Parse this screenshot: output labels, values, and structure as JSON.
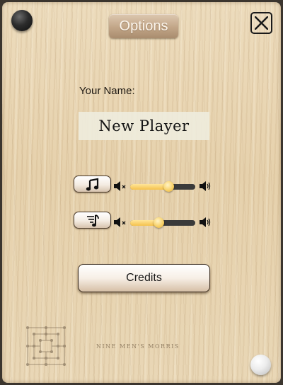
{
  "header": {
    "title": "Options",
    "close_icon": "close-icon"
  },
  "player": {
    "name_label": "Your Name:",
    "name_value": "New Player"
  },
  "audio": {
    "music": {
      "icon": "music-note-icon",
      "volume": 0.59
    },
    "sfx": {
      "icon": "sound-effects-icon",
      "volume": 0.43
    },
    "mute_icon": "speaker-mute-icon",
    "loud_icon": "speaker-loud-icon"
  },
  "credits_label": "Credits",
  "footer": {
    "game_name": "NINE MEN'S MORRIS",
    "logo_icon": "board-logo-icon"
  },
  "pieces": {
    "top_left": "black-stone",
    "bottom_right": "white-stone"
  },
  "colors": {
    "wood": "#e8d5b3",
    "slider_fill": "#f5c24b",
    "slider_track": "#3a3a3a"
  }
}
